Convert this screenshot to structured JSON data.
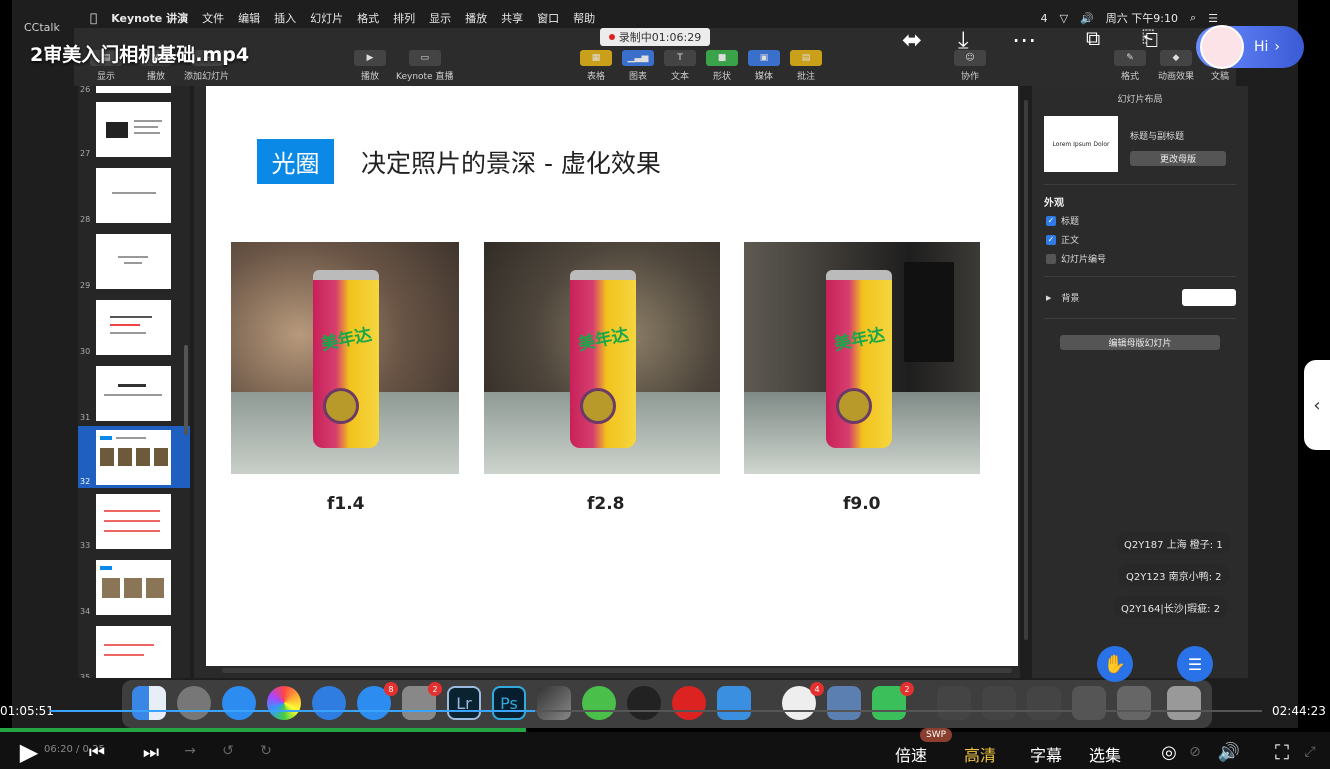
{
  "video": {
    "title": "2审美入门相机基础.mp4",
    "app_watermark": "CCtalk",
    "elapsed": "01:05:51",
    "duration": "02:44:23",
    "progress_fraction": 0.4,
    "mini_time": "06:20 / 0  25"
  },
  "menubar": {
    "app": "Keynote 讲演",
    "items": [
      "文件",
      "编辑",
      "插入",
      "幻灯片",
      "格式",
      "排列",
      "显示",
      "播放",
      "共享",
      "窗口",
      "帮助"
    ],
    "clock": "周六 下午9:10",
    "battery_badge": "4"
  },
  "recording": {
    "label": "录制中01:06:29"
  },
  "toolbar": {
    "left": [
      "显示",
      "播放",
      "添加幻灯片"
    ],
    "play": "播放",
    "keynote_live": "Keynote 直播",
    "insert": [
      "表格",
      "图表",
      "文本",
      "形状",
      "媒体",
      "批注"
    ],
    "collab": "协作",
    "right": [
      "格式",
      "动画效果",
      "文稿"
    ]
  },
  "navigator": {
    "slides": [
      {
        "num": "26"
      },
      {
        "num": "27"
      },
      {
        "num": "28"
      },
      {
        "num": "29"
      },
      {
        "num": "30"
      },
      {
        "num": "31"
      },
      {
        "num": "32",
        "active": true
      },
      {
        "num": "33"
      },
      {
        "num": "34"
      },
      {
        "num": "35"
      }
    ]
  },
  "slide": {
    "tag": "光圈",
    "heading": "决定照片的景深 - 虚化效果",
    "photos": [
      {
        "fstop": "f1.4",
        "can_text": "美年达"
      },
      {
        "fstop": "f2.8",
        "can_text": "美年达"
      },
      {
        "fstop": "f9.0",
        "can_text": "美年达"
      }
    ]
  },
  "inspector": {
    "title": "幻灯片布局",
    "layout_thumb_text": "Lorem Ipsum Dolor",
    "layout_name": "标题与副标题",
    "change_master": "更改母版",
    "appearance": "外观",
    "checks": [
      {
        "label": "标题",
        "checked": true
      },
      {
        "label": "正文",
        "checked": true
      },
      {
        "label": "幻灯片编号",
        "checked": false
      }
    ],
    "background": "背景",
    "edit_master": "编辑母版幻灯片"
  },
  "hi_button": {
    "label": "Hi"
  },
  "chat": [
    "Q2Y187 上海 橙子: 1",
    "Q2Y123 南京小鸭: 2",
    "Q2Y164|长沙|瑕疵: 2"
  ],
  "dock": {
    "badges": [
      "8",
      "2",
      "4",
      "2"
    ],
    "lr": "Lr",
    "ps": "Ps"
  },
  "player": {
    "speed": "倍速",
    "quality": "高清",
    "subtitle": "字幕",
    "episodes": "选集",
    "swp": "SWP"
  }
}
